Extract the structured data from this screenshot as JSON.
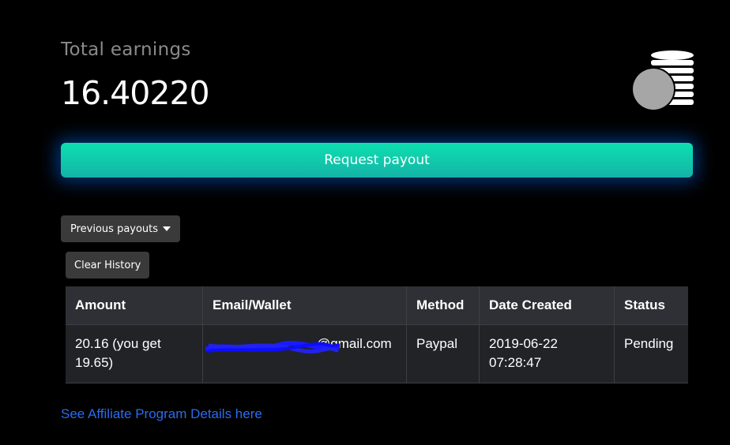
{
  "earnings": {
    "label": "Total earnings",
    "value_major": "16.40",
    "value_minor": "220"
  },
  "icons": {
    "coins": "coins-stack-icon",
    "dropdown": "caret-down-icon"
  },
  "colors": {
    "background": "#000000",
    "payout_button_top": "#0de0b0",
    "payout_button_bottom": "#14b3a6",
    "payout_glow": "#006eff",
    "secondary_button": "#3a3a3a",
    "link": "#2a6cf0",
    "table_header": "#2e3035",
    "table_body": "#212327",
    "redaction": "#1a1aff"
  },
  "actions": {
    "request_payout": "Request payout",
    "previous_payouts": "Previous payouts",
    "clear_history": "Clear History"
  },
  "table": {
    "headers": {
      "amount": "Amount",
      "email": "Email/Wallet",
      "method": "Method",
      "date": "Date Created",
      "status": "Status"
    },
    "rows": [
      {
        "amount": "20.16 (you get 19.65)",
        "email": "@gmail.com",
        "method": "Paypal",
        "date": "2019-06-22 07:28:47",
        "status": "Pending"
      }
    ]
  },
  "footer": {
    "affiliate_link": "See Affiliate Program Details here"
  }
}
